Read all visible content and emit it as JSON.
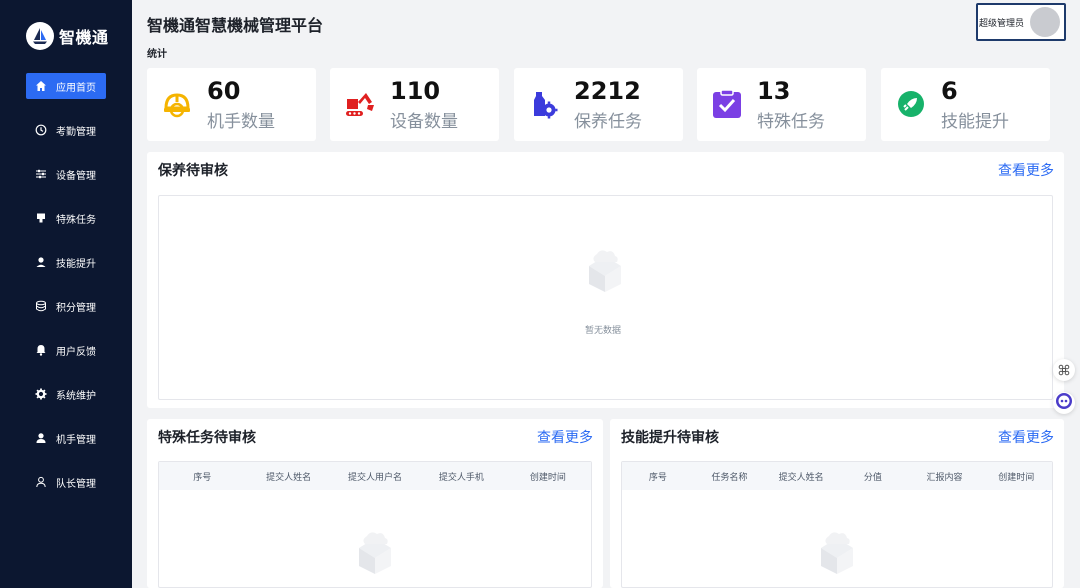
{
  "app": {
    "logo_text": "智機通",
    "page_title": "智機通智慧機械管理平台",
    "section_label": "统计"
  },
  "user": {
    "name": "超级管理员"
  },
  "sidebar": {
    "items": [
      {
        "label": "应用首页",
        "icon": "home-icon",
        "active": true
      },
      {
        "label": "考勤管理",
        "icon": "clock-icon"
      },
      {
        "label": "设备管理",
        "icon": "sliders-icon"
      },
      {
        "label": "特殊任务",
        "icon": "flag-icon"
      },
      {
        "label": "技能提升",
        "icon": "person-icon"
      },
      {
        "label": "积分管理",
        "icon": "database-icon"
      },
      {
        "label": "用户反馈",
        "icon": "bell-icon"
      },
      {
        "label": "系统维护",
        "icon": "gear-icon"
      },
      {
        "label": "机手管理",
        "icon": "user-icon"
      },
      {
        "label": "队长管理",
        "icon": "user-outline-icon"
      }
    ]
  },
  "stats": [
    {
      "value": "60",
      "label": "机手数量",
      "icon": "helmet-icon",
      "color": "#f5b400"
    },
    {
      "value": "110",
      "label": "设备数量",
      "icon": "excavator-icon",
      "color": "#e02020"
    },
    {
      "value": "2212",
      "label": "保养任务",
      "icon": "maintenance-icon",
      "color": "#3b3bdc"
    },
    {
      "value": "13",
      "label": "特殊任务",
      "icon": "clipboard-check-icon",
      "color": "#7b3fe4"
    },
    {
      "value": "6",
      "label": "技能提升",
      "icon": "rocket-icon",
      "color": "#17b26a"
    }
  ],
  "maintenance_review": {
    "title": "保养待审核",
    "more": "查看更多",
    "empty_text": "暂无数据"
  },
  "special_review": {
    "title": "特殊任务待审核",
    "more": "查看更多",
    "columns": [
      "序号",
      "提交人姓名",
      "提交人用户名",
      "提交人手机",
      "创建时间"
    ]
  },
  "skill_review": {
    "title": "技能提升待审核",
    "more": "查看更多",
    "columns": [
      "序号",
      "任务名称",
      "提交人姓名",
      "分值",
      "汇报内容",
      "创建时间"
    ]
  },
  "colors": {
    "accent": "#2c6bf3",
    "sidebar_bg": "#0c1730"
  }
}
